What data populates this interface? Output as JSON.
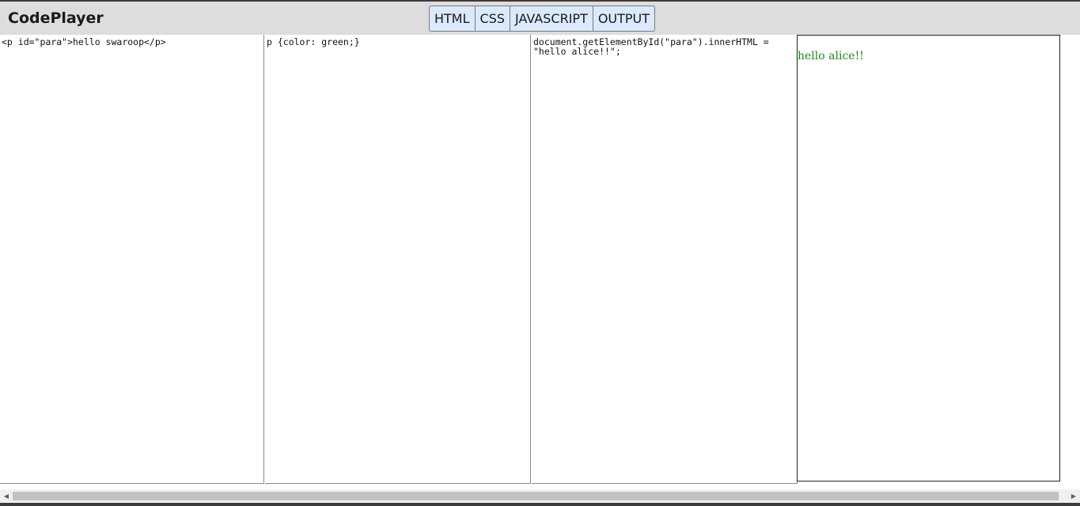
{
  "app": {
    "logo": "CodePlayer"
  },
  "toggles": [
    "HTML",
    "CSS",
    "JAVASCRIPT",
    "OUTPUT"
  ],
  "panels": {
    "html_code": "<p id=\"para\">hello swaroop</p>",
    "css_code": "p {color: green;}",
    "js_code": "document.getElementById(\"para\").innerHTML = \"hello alice!!\";"
  },
  "output": {
    "text": "hello alice!!"
  },
  "scrollbar": {
    "left_arrow": "◀",
    "right_arrow": "▶"
  },
  "colors": {
    "topbar": "#dedddd",
    "toggle_bg": "#dbe9fd",
    "output_text": "#1d8a1d"
  }
}
